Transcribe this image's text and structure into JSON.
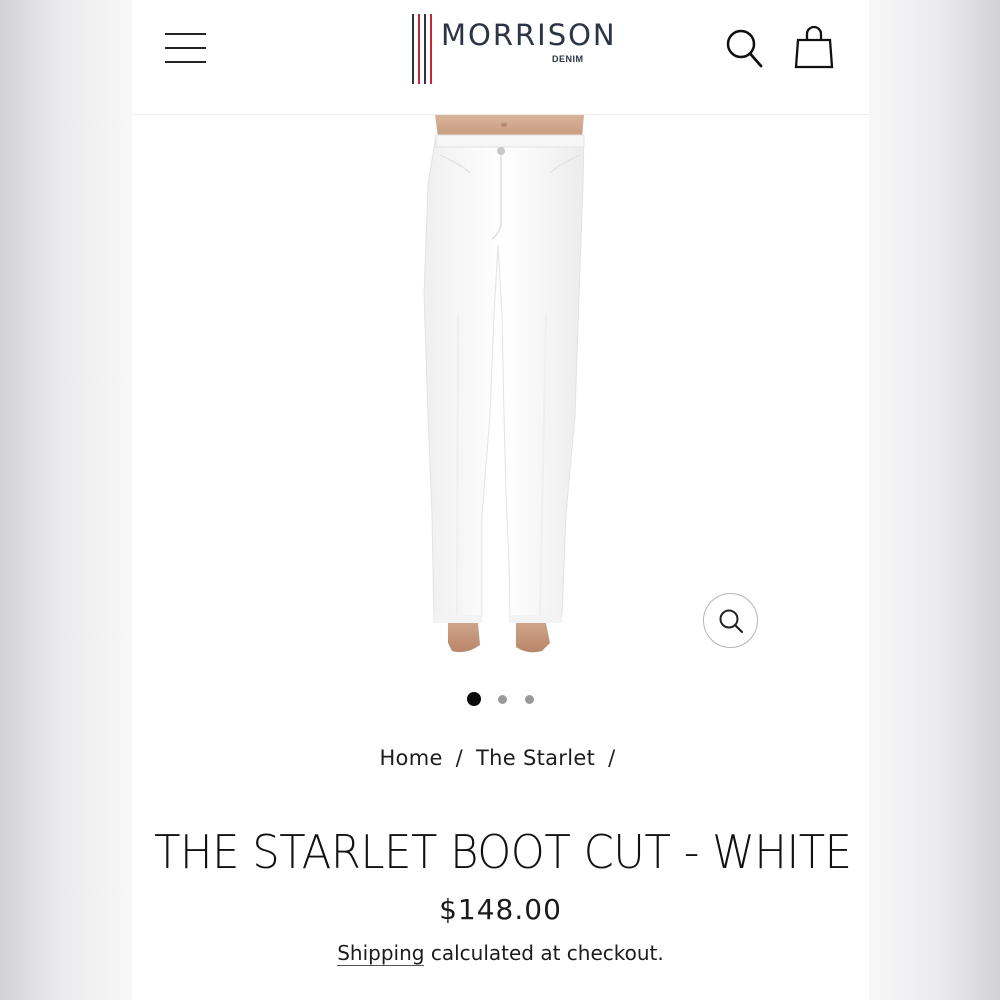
{
  "brand": {
    "name": "MORRISON",
    "sub": "DENIM",
    "stripe_colors": [
      "#2c3445",
      "#c8253a",
      "#2c3445",
      "#c8253a"
    ]
  },
  "header": {
    "menu_icon": "hamburger-menu-icon",
    "search_icon": "search-icon",
    "cart_icon": "shopping-bag-icon"
  },
  "gallery": {
    "slide_count": 3,
    "active_slide": 1,
    "zoom_icon": "zoom-search-icon"
  },
  "breadcrumb": {
    "home": "Home",
    "collection": "The Starlet",
    "separator": "/"
  },
  "product": {
    "title": "THE STARLET BOOT CUT - WHITE",
    "price": "$148.00",
    "shipping_link": "Shipping",
    "shipping_text": "calculated at checkout."
  },
  "colors": {
    "text": "#1c1c1c",
    "brand_navy": "#2c3445",
    "brand_red": "#c8253a"
  }
}
